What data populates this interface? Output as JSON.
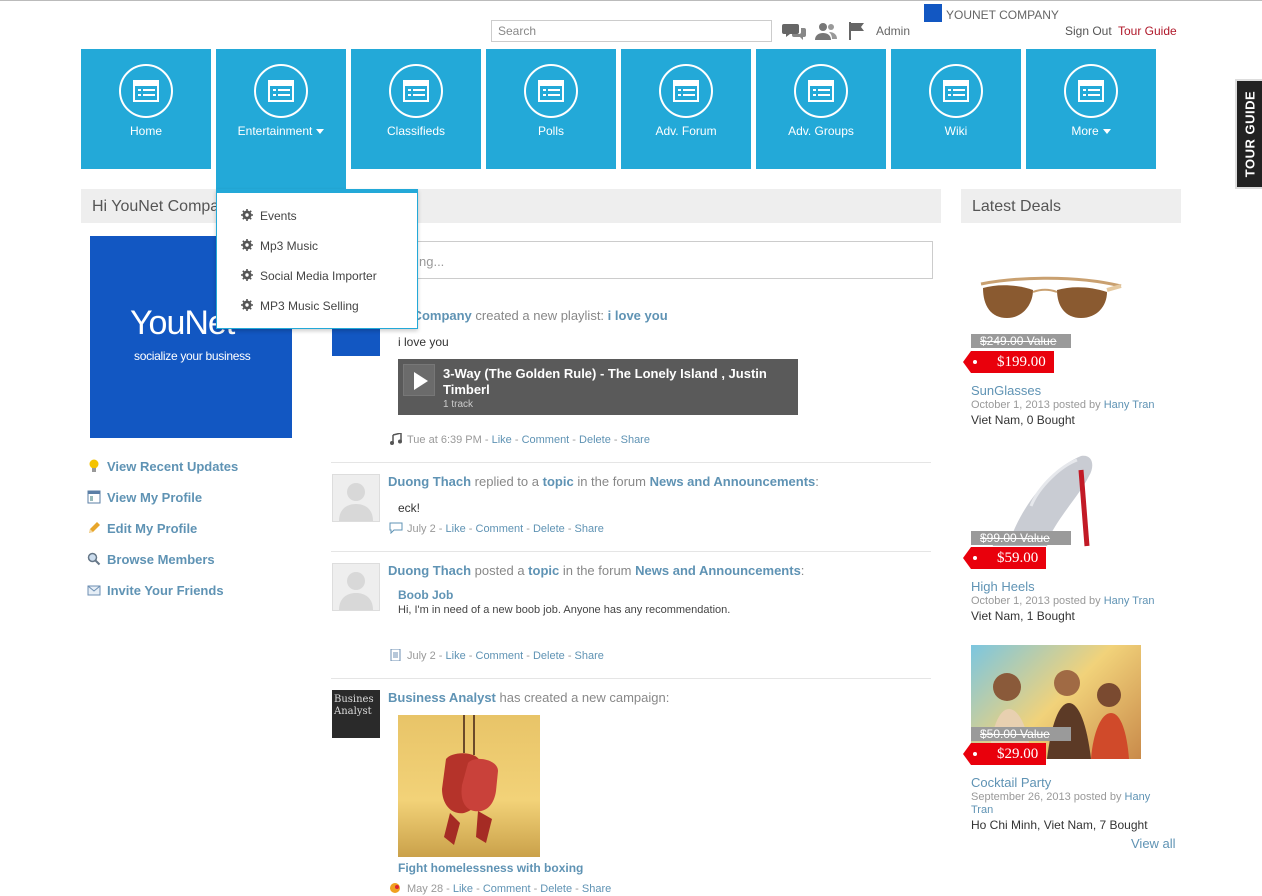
{
  "header": {
    "search_placeholder": "Search",
    "admin_label": "Admin",
    "company_name": "YOUNET COMPANY",
    "sign_out": "Sign Out",
    "tour_guide": "Tour Guide"
  },
  "nav": {
    "items": [
      {
        "label": "Home"
      },
      {
        "label": "Entertainment"
      },
      {
        "label": "Classifieds"
      },
      {
        "label": "Polls"
      },
      {
        "label": "Adv. Forum"
      },
      {
        "label": "Adv. Groups"
      },
      {
        "label": "Wiki"
      },
      {
        "label": "More"
      }
    ]
  },
  "dropdown": {
    "items": [
      "Events",
      "Mp3 Music",
      "Social Media Importer",
      "MP3 Music Selling"
    ]
  },
  "left": {
    "greeting": "Hi YouNet Compa",
    "brand": "YouNet",
    "tagline": "socialize your business",
    "links": [
      "View Recent Updates",
      "View My Profile",
      "Edit My Profile",
      "Browse Members",
      "Invite Your Friends"
    ]
  },
  "status": {
    "placeholder": "ng..."
  },
  "feed": [
    {
      "author": "Net Company",
      "action": "created a new playlist:",
      "target": "i love you",
      "body": "i love you",
      "player_title": "3-Way (The Golden Rule) - The Lonely Island , Justin Timberl",
      "player_tracks": "1 track",
      "time": "Tue at 6:39 PM",
      "like": "Like",
      "comment": "Comment",
      "delete": "Delete",
      "share": "Share"
    },
    {
      "author": "Duong Thach",
      "action": "replied to a",
      "topic": "topic",
      "mid": "in the forum",
      "forum": "News and Announcements",
      "colon": ":",
      "body": "eck!",
      "time": "July 2",
      "like": "Like",
      "comment": "Comment",
      "delete": "Delete",
      "share": "Share"
    },
    {
      "author": "Duong Thach",
      "action": "posted a",
      "topic": "topic",
      "mid": "in the forum",
      "forum": "News and Announcements",
      "colon": ":",
      "post_title": "Boob Job",
      "post_desc": "Hi, I'm in need of a new boob job. Anyone has any recommendation.",
      "time": "July 2",
      "like": "Like",
      "comment": "Comment",
      "delete": "Delete",
      "share": "Share"
    },
    {
      "author": "Business Analyst",
      "action": "has created a new campaign:",
      "avatar_text": "Busines Analyst",
      "campaign_title": "Fight homelessness with boxing",
      "time": "May 28",
      "like": "Like",
      "comment": "Comment",
      "delete": "Delete",
      "share": "Share"
    }
  ],
  "deals": {
    "title": "Latest Deals",
    "items": [
      {
        "old": "$249.00 Value",
        "price": "$199.00",
        "name": "SunGlasses",
        "date": "October 1, 2013 posted by",
        "by": "Hany Tran",
        "loc": "Viet Nam, 0 Bought"
      },
      {
        "old": "$99.00 Value",
        "price": "$59.00",
        "name": "High Heels",
        "date": "October 1, 2013 posted by",
        "by": "Hany Tran",
        "loc": "Viet Nam, 1 Bought"
      },
      {
        "old": "$50.00 Value",
        "price": "$29.00",
        "name": "Cocktail Party",
        "date": "September 26, 2013 posted by",
        "by": "Hany",
        "by2": "Tran",
        "loc": "Ho Chi Minh, Viet Nam, 7 Bought"
      }
    ],
    "view_all": "View all"
  },
  "tour_tab": "TOUR GUIDE",
  "colors": {
    "tile": "#23a9d8",
    "link": "#5f93b4",
    "price": "#e9000c",
    "brand": "#1257c2"
  }
}
